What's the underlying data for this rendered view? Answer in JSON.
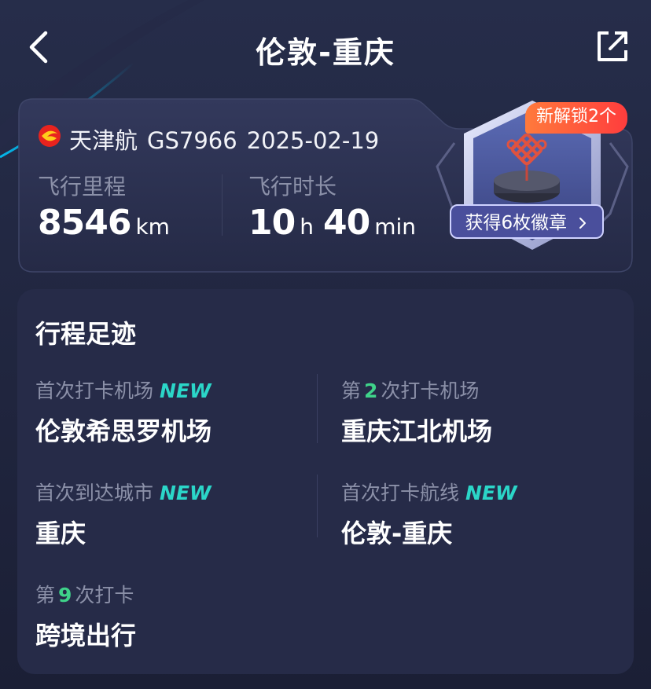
{
  "header": {
    "title": "伦敦-重庆",
    "back_icon": "chevron-left-icon",
    "share_icon": "share-icon"
  },
  "flight": {
    "airline": "天津航",
    "flight_no": "GS7966",
    "date": "2025-02-19",
    "distance_label": "飞行里程",
    "distance_value": "8546",
    "distance_unit": "km",
    "duration_label": "飞行时长",
    "duration_hours": "10",
    "duration_hours_unit": "h",
    "duration_minutes": "40",
    "duration_minutes_unit": "min"
  },
  "badge": {
    "new_tag": "新解锁2个",
    "button_label": "获得6枚徽章",
    "button_icon": "chevron-right-icon"
  },
  "trip": {
    "title": "行程足迹",
    "new_text": "NEW",
    "items": [
      {
        "label": "首次打卡机场",
        "value": "伦敦希思罗机场"
      },
      {
        "label_prefix": "第",
        "label_num": "2",
        "label_suffix": "次打卡机场",
        "value": "重庆江北机场"
      },
      {
        "label": "首次到达城市",
        "value": "重庆"
      },
      {
        "label": "首次打卡航线",
        "value": "伦敦-重庆"
      },
      {
        "label_prefix": "第",
        "label_num": "9",
        "label_suffix": "次打卡",
        "value": "跨境出行"
      }
    ]
  },
  "colors": {
    "background": "#1b1f35",
    "card": "#262b48",
    "accent_new": "#2bd6c8",
    "accent_count": "#3fd38a",
    "badge_tag": "#ff4d3d"
  }
}
